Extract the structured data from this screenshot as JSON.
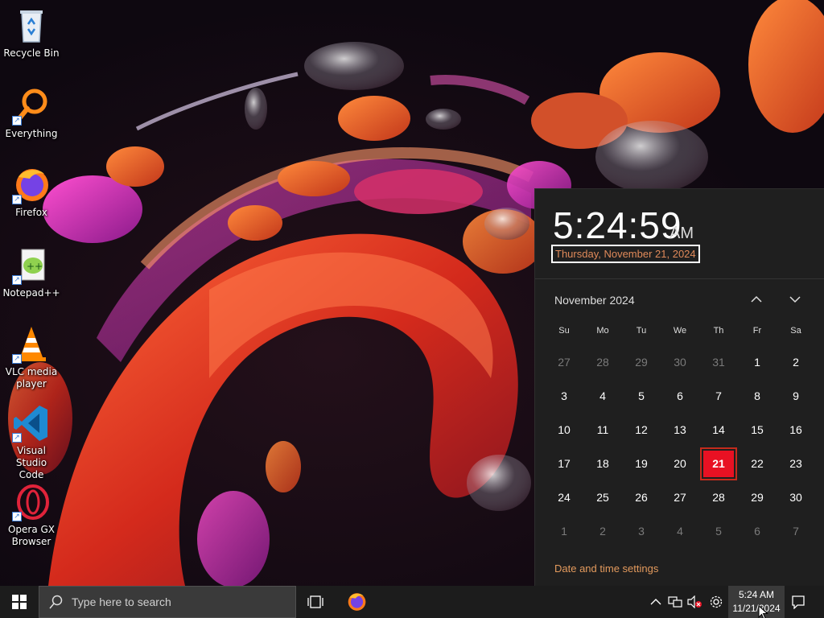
{
  "desktop": {
    "icons": [
      {
        "label": "Recycle Bin",
        "icon": "recycle-bin-icon"
      },
      {
        "label": "Everything",
        "icon": "everything-search-icon"
      },
      {
        "label": "Firefox",
        "icon": "firefox-icon"
      },
      {
        "label": "Notepad++",
        "icon": "notepad-plus-plus-icon"
      },
      {
        "label": "VLC media player",
        "icon": "vlc-cone-icon"
      },
      {
        "label": "Visual Studio Code",
        "icon": "vscode-icon"
      },
      {
        "label": "Opera GX Browser",
        "icon": "opera-gx-icon"
      }
    ]
  },
  "flyout": {
    "time": "5:24:59",
    "ampm": "AM",
    "long_date": "Thursday, November 21, 2024",
    "month_label": "November 2024",
    "weekdays": [
      "Su",
      "Mo",
      "Tu",
      "We",
      "Th",
      "Fr",
      "Sa"
    ],
    "days": [
      {
        "d": "27",
        "muted": true
      },
      {
        "d": "28",
        "muted": true
      },
      {
        "d": "29",
        "muted": true
      },
      {
        "d": "30",
        "muted": true
      },
      {
        "d": "31",
        "muted": true
      },
      {
        "d": "1"
      },
      {
        "d": "2"
      },
      {
        "d": "3"
      },
      {
        "d": "4"
      },
      {
        "d": "5"
      },
      {
        "d": "6"
      },
      {
        "d": "7"
      },
      {
        "d": "8"
      },
      {
        "d": "9"
      },
      {
        "d": "10"
      },
      {
        "d": "11"
      },
      {
        "d": "12"
      },
      {
        "d": "13"
      },
      {
        "d": "14"
      },
      {
        "d": "15"
      },
      {
        "d": "16"
      },
      {
        "d": "17"
      },
      {
        "d": "18"
      },
      {
        "d": "19"
      },
      {
        "d": "20"
      },
      {
        "d": "21",
        "today": true
      },
      {
        "d": "22"
      },
      {
        "d": "23"
      },
      {
        "d": "24"
      },
      {
        "d": "25"
      },
      {
        "d": "26"
      },
      {
        "d": "27"
      },
      {
        "d": "28"
      },
      {
        "d": "29"
      },
      {
        "d": "30"
      },
      {
        "d": "1",
        "muted": true
      },
      {
        "d": "2",
        "muted": true
      },
      {
        "d": "3",
        "muted": true
      },
      {
        "d": "4",
        "muted": true
      },
      {
        "d": "5",
        "muted": true
      },
      {
        "d": "6",
        "muted": true
      },
      {
        "d": "7",
        "muted": true
      }
    ],
    "settings_link": "Date and time settings",
    "colors": {
      "today": "#e81123",
      "accent_text": "#e39a5d"
    }
  },
  "taskbar": {
    "search_placeholder": "Type here to search",
    "clock_time": "5:24 AM",
    "clock_date": "11/21/2024",
    "tray_icons": [
      "chevron-up-icon",
      "network-icon",
      "volume-muted-icon",
      "settings-gear-icon"
    ]
  }
}
